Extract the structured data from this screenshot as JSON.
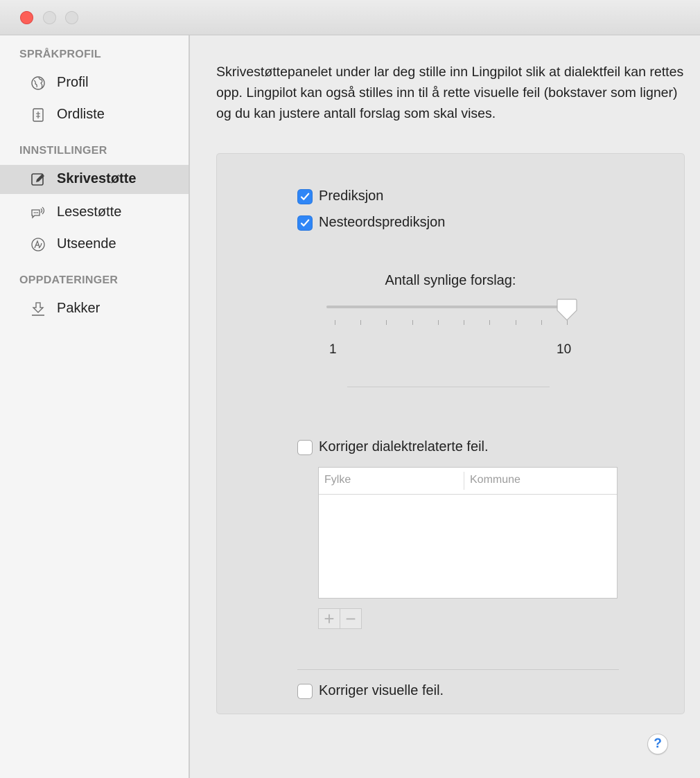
{
  "sidebar": {
    "sections": [
      {
        "heading": "SPRÅKPROFIL"
      },
      {
        "heading": "INNSTILLINGER"
      },
      {
        "heading": "OPPDATERINGER"
      }
    ],
    "items": [
      {
        "label": "Profil",
        "icon": "globe-icon"
      },
      {
        "label": "Ordliste",
        "icon": "dictionary-icon"
      },
      {
        "label": "Skrivestøtte",
        "icon": "pencil-icon",
        "selected": true
      },
      {
        "label": "Lesestøtte",
        "icon": "speech-icon"
      },
      {
        "label": "Utseende",
        "icon": "appearance-icon"
      },
      {
        "label": "Pakker",
        "icon": "download-icon"
      }
    ]
  },
  "main": {
    "description": "Skrivestøttepanelet under lar deg stille inn Lingpilot slik at dialektfeil kan rettes opp. Lingpilot kan også stilles inn til å rette visuelle feil (bokstaver som ligner) og du kan justere antall forslag som skal vises.",
    "checkboxes": {
      "prediction": {
        "label": "Prediksjon",
        "checked": true
      },
      "next_word": {
        "label": "Nesteordsprediksjon",
        "checked": true
      },
      "dialect": {
        "label": "Korriger dialektrelaterte feil.",
        "checked": false
      },
      "visual": {
        "label": "Korriger visuelle feil.",
        "checked": false
      }
    },
    "slider": {
      "title": "Antall synlige forslag:",
      "min_label": "1",
      "max_label": "10",
      "min": 1,
      "max": 10,
      "value": 10
    },
    "table": {
      "columns": [
        "Fylke",
        "Kommune"
      ]
    },
    "add_label": "+",
    "remove_label": "−",
    "help_label": "?"
  },
  "colors": {
    "accent": "#2f86f6",
    "close_button": "#fc5f57"
  }
}
